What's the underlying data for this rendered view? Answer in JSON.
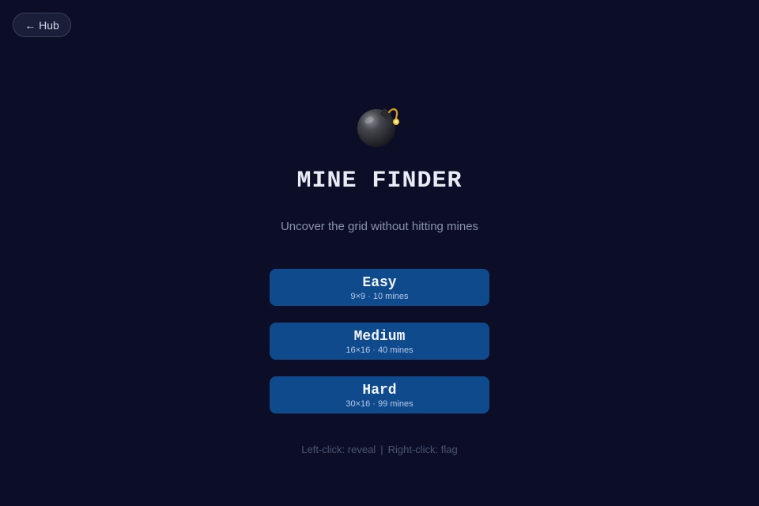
{
  "nav": {
    "hub_label": "← Hub"
  },
  "header": {
    "title": "MINE FINDER",
    "subtitle": "Uncover the grid without hitting mines"
  },
  "difficulties": [
    {
      "label": "Easy",
      "info": "9×9 · 10 mines"
    },
    {
      "label": "Medium",
      "info": "16×16 · 40 mines"
    },
    {
      "label": "Hard",
      "info": "30×16 · 99 mines"
    }
  ],
  "help": {
    "left": "Left-click: reveal",
    "separator": "|",
    "right": "Right-click: flag"
  },
  "colors": {
    "background": "#0b0e26",
    "button": "#0f4a8c",
    "title": "#e9ecf5"
  },
  "icons": {
    "logo": "bomb-icon"
  }
}
